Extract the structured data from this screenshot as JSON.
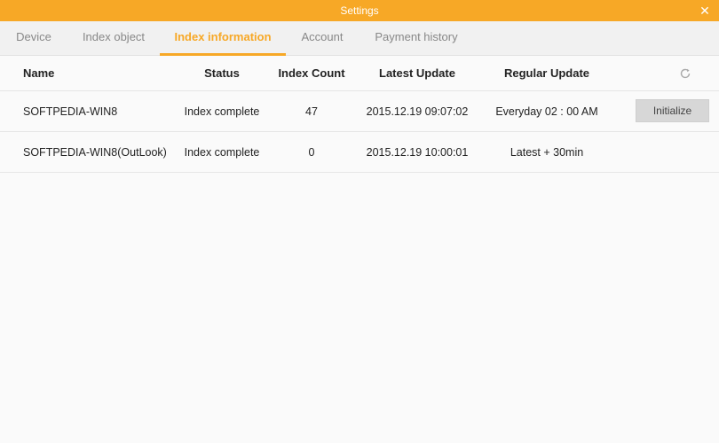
{
  "window": {
    "title": "Settings",
    "close_glyph": "✕"
  },
  "tabs": [
    {
      "label": "Device",
      "active": false
    },
    {
      "label": "Index object",
      "active": false
    },
    {
      "label": "Index information",
      "active": true
    },
    {
      "label": "Account",
      "active": false
    },
    {
      "label": "Payment history",
      "active": false
    }
  ],
  "table": {
    "headers": {
      "name": "Name",
      "status": "Status",
      "index_count": "Index Count",
      "latest_update": "Latest Update",
      "regular_update": "Regular Update"
    },
    "refresh_icon": "refresh-icon",
    "rows": [
      {
        "name": "SOFTPEDIA-WIN8",
        "status": "Index complete",
        "index_count": "47",
        "latest_update": "2015.12.19 09:07:02",
        "regular_update": "Everyday 02 : 00 AM",
        "action_label": "Initialize"
      },
      {
        "name": "SOFTPEDIA-WIN8(OutLook)",
        "status": "Index complete",
        "index_count": "0",
        "latest_update": "2015.12.19 10:00:01",
        "regular_update": "Latest + 30min"
      }
    ]
  },
  "colors": {
    "accent": "#f7a826",
    "button_bg": "#d7d7d7"
  }
}
